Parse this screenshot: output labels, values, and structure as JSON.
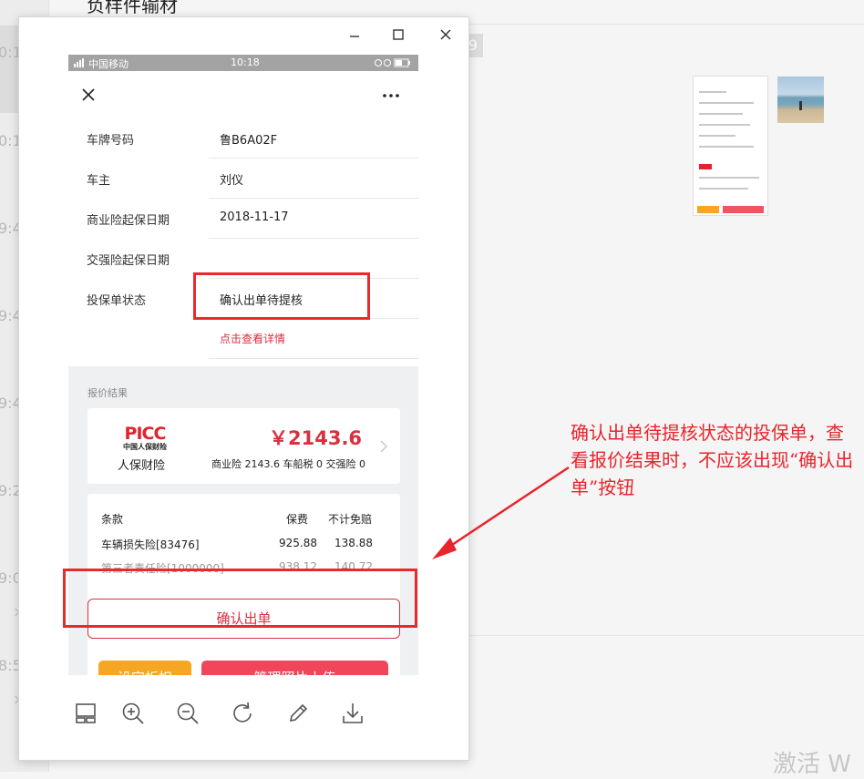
{
  "background": {
    "title": "负样件输材",
    "badge": "9",
    "timestamps": [
      "0:1",
      "0:1",
      "9:4",
      "9:4",
      "9:4",
      "9:2",
      "9:0",
      "8:5"
    ],
    "watermark": "激活 W"
  },
  "statusbar": {
    "carrier": "中国移动",
    "time": "10:18"
  },
  "form": {
    "rows": [
      {
        "label": "车牌号码",
        "value": "鲁B6A02F"
      },
      {
        "label": "车主",
        "value": "刘仪"
      },
      {
        "label": "商业险起保日期",
        "value": "2018-11-17"
      },
      {
        "label": "交强险起保日期",
        "value": ""
      },
      {
        "label": "投保单状态",
        "value": "确认出单待提核"
      }
    ],
    "detail_link": "点击查看详情"
  },
  "quote": {
    "section_label": "报价结果",
    "logo_text": "PICC",
    "logo_subtext": "中国人保财险",
    "company": "人保财险",
    "price": "￥2143.6",
    "breakdown": "商业险 2143.6 车船税 0 交强险 0"
  },
  "coverage": {
    "headers": {
      "item": "条款",
      "premium": "保费",
      "excess": "不计免赔"
    },
    "rows": [
      {
        "item": "车辆损失险[83476]",
        "premium": "925.88",
        "excess": "138.88"
      },
      {
        "item": "第三者责任险[1000000]",
        "premium": "938.12",
        "excess": "140.72"
      }
    ]
  },
  "buttons": {
    "confirm": "确认出单",
    "discount": "设定折扣",
    "upload": "管理照片上传"
  },
  "annotation": "确认出单待提核状态的投保单，查看报价结果时，不应该出现“确认出单”按钮",
  "colors": {
    "accent_red": "#d9303f",
    "annotation_red": "#e8242c",
    "orange": "#f5a623",
    "upload_red": "#f1465a"
  }
}
